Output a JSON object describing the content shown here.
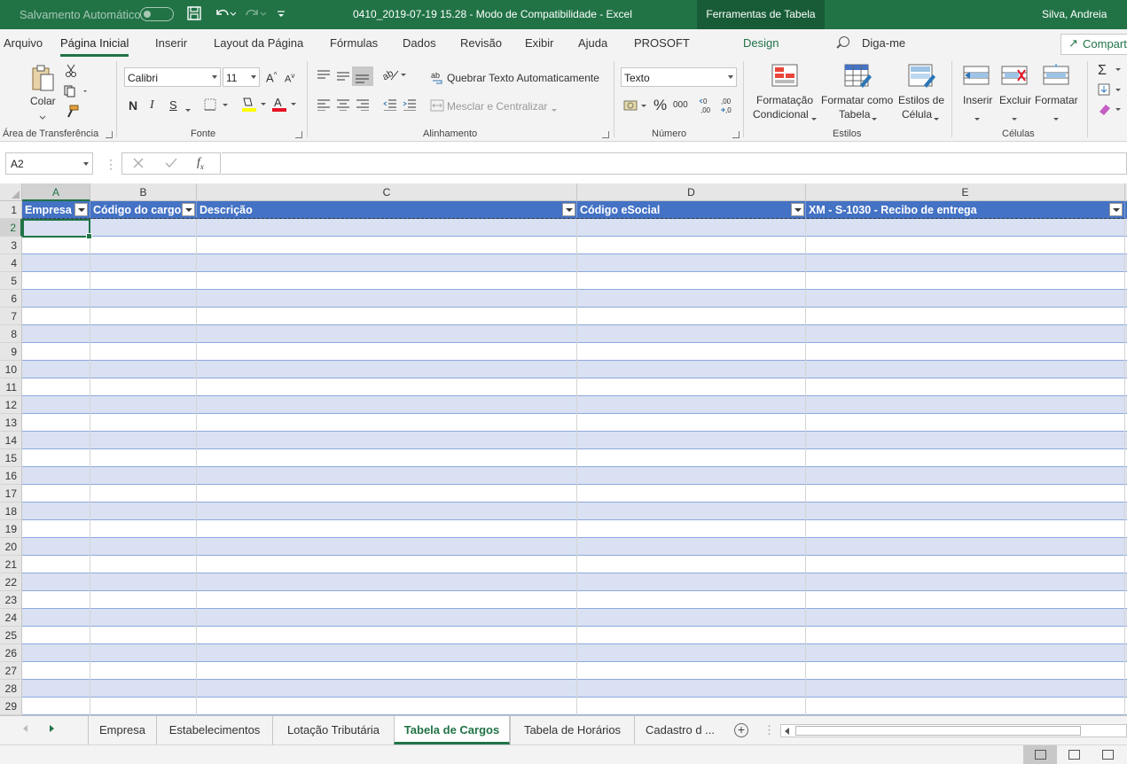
{
  "titlebar": {
    "autosave_label": "Salvamento Automático",
    "document_title": "0410_2019-07-19 15.28  -  Modo de Compatibilidade  -  Excel",
    "contextual_tab": "Ferramentas de Tabela",
    "user_name": "Silva, Andreia"
  },
  "tabs": {
    "arquivo": "Arquivo",
    "pagina_inicial": "Página Inicial",
    "inserir": "Inserir",
    "layout": "Layout da Página",
    "formulas": "Fórmulas",
    "dados": "Dados",
    "revisao": "Revisão",
    "exibir": "Exibir",
    "ajuda": "Ajuda",
    "prosoft": "PROSOFT",
    "design": "Design",
    "tell_me": "Diga-me",
    "share": "Compartilhar"
  },
  "ribbon": {
    "clipboard": {
      "paste": "Colar",
      "group": "Área de Transferência"
    },
    "font": {
      "name": "Calibri",
      "size": "11",
      "bold": "N",
      "italic": "I",
      "underline": "S",
      "group": "Fonte",
      "grow": "A^",
      "shrink": "Aˇ"
    },
    "alignment": {
      "wrap": "Quebrar Texto Automaticamente",
      "merge": "Mesclar e Centralizar",
      "group": "Alinhamento"
    },
    "number": {
      "format": "Texto",
      "percent": "%",
      "thousands": "000",
      "group": "Número"
    },
    "styles": {
      "conditional_1": "Formatação",
      "conditional_2": "Condicional",
      "table_1": "Formatar como",
      "table_2": "Tabela",
      "cell_1": "Estilos de",
      "cell_2": "Célula",
      "group": "Estilos"
    },
    "cells": {
      "insert": "Inserir",
      "delete": "Excluir",
      "format": "Formatar",
      "group": "Células"
    }
  },
  "formula_bar": {
    "name_box": "A2",
    "fx": "fx",
    "value": ""
  },
  "grid": {
    "columns": [
      "A",
      "B",
      "C",
      "D",
      "E"
    ],
    "rows": [
      "1",
      "2",
      "3",
      "4",
      "5",
      "6",
      "7",
      "8",
      "9",
      "10",
      "11",
      "12",
      "13",
      "14",
      "15",
      "16",
      "17",
      "18",
      "19",
      "20",
      "21",
      "22",
      "23",
      "24",
      "25",
      "26",
      "27",
      "28",
      "29"
    ],
    "table_headers": [
      "Empresa",
      "Código do cargo",
      "Descrição",
      "Código eSocial",
      "XM - S-1030 - Recibo de entrega"
    ],
    "selected_cell": "A2"
  },
  "sheets": {
    "tabs": [
      "Empresa",
      "Estabelecimentos",
      "Lotação Tributária",
      "Tabela de Cargos",
      "Tabela de Horários",
      "Cadastro d ..."
    ],
    "active": "Tabela de Cargos"
  },
  "colors": {
    "accent": "#217346",
    "table_header": "#4472c4",
    "band": "#d9e1f2"
  }
}
